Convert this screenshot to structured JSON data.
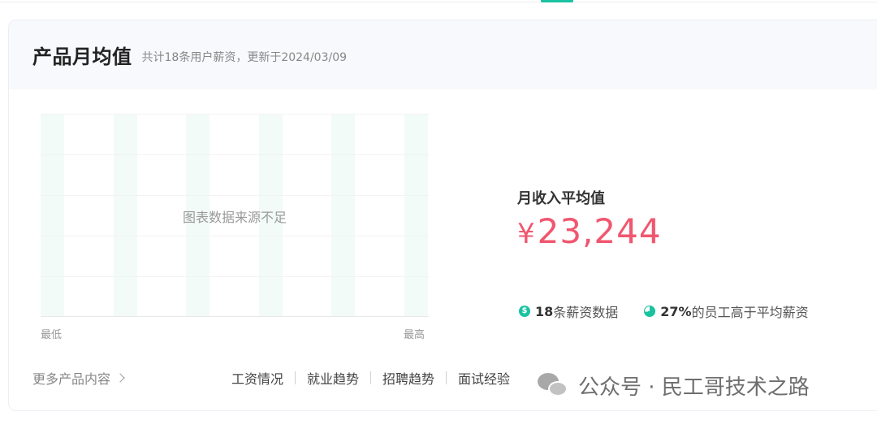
{
  "header": {
    "title": "产品月均值",
    "subtitle": "共计18条用户薪资，更新于2024/03/09"
  },
  "chart": {
    "empty_message": "图表数据来源不足",
    "axis_low": "最低",
    "axis_high": "最高"
  },
  "average": {
    "label": "月收入平均值",
    "currency": "¥",
    "value": "23,244"
  },
  "stats": {
    "records_count": "18",
    "records_text": "条薪资数据",
    "above_avg_percent": "27%",
    "above_avg_text": "的员工高于平均薪资"
  },
  "footer": {
    "more_label": "更多产品内容",
    "links": [
      "工资情况",
      "就业趋势",
      "招聘趋势",
      "面试经验"
    ]
  },
  "watermark": {
    "text": "公众号 · 民工哥技术之路"
  },
  "colors": {
    "accent": "#19c2a0",
    "salary": "#f0576f"
  }
}
